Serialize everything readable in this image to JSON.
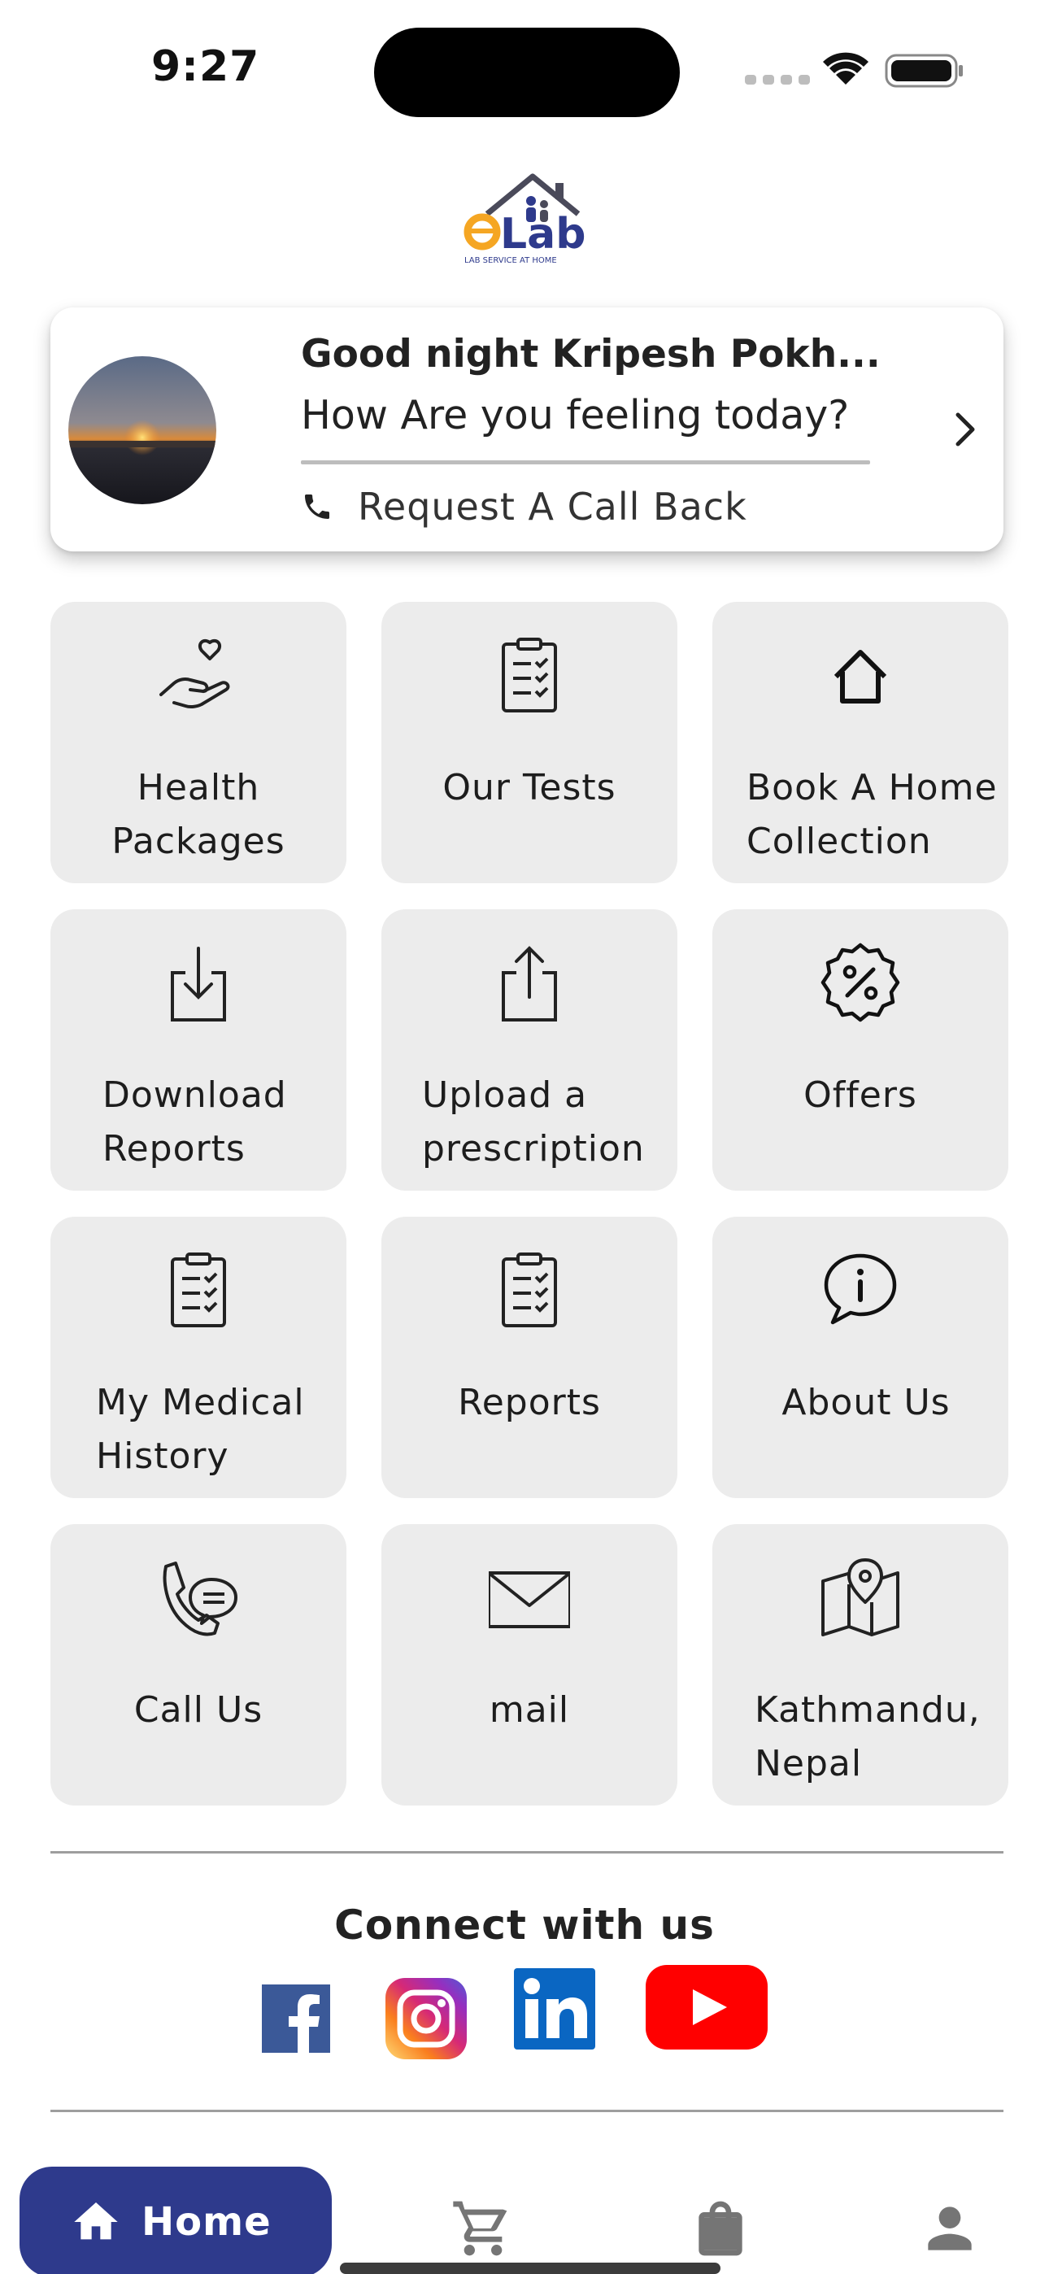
{
  "status_bar": {
    "time": "9:27"
  },
  "brand": {
    "logo_text": "eLab",
    "tagline": "LAB SERVICE AT HOME"
  },
  "greeting": {
    "title": "Good night Kripesh Pokh...",
    "subtitle": "How Are you feeling today?",
    "callback_label": "Request A Call Back"
  },
  "tiles": [
    {
      "label": "Health Packages",
      "icon": "heart-hand-icon"
    },
    {
      "label": "Our Tests",
      "icon": "clipboard-check-icon"
    },
    {
      "label": "Book A Home Collection",
      "icon": "home-icon"
    },
    {
      "label": "Download Reports",
      "icon": "download-icon"
    },
    {
      "label": "Upload a prescription",
      "icon": "upload-icon"
    },
    {
      "label": "Offers",
      "icon": "percent-badge-icon"
    },
    {
      "label": "My Medical History",
      "icon": "clipboard-check-icon"
    },
    {
      "label": "Reports",
      "icon": "clipboard-check-icon"
    },
    {
      "label": "About Us",
      "icon": "info-chat-icon"
    },
    {
      "label": "Call Us",
      "icon": "phone-chat-icon"
    },
    {
      "label": "mail",
      "icon": "envelope-icon"
    },
    {
      "label": "Kathmandu, Nepal",
      "icon": "map-pin-icon"
    }
  ],
  "connect": {
    "title": "Connect with us",
    "links": [
      "facebook",
      "instagram",
      "linkedin",
      "youtube"
    ]
  },
  "bottom_nav": {
    "home_label": "Home",
    "items": [
      "home",
      "cart",
      "shopping-bag",
      "profile"
    ]
  },
  "colors": {
    "primary": "#2e3a8c",
    "tile_bg": "#ececec",
    "logo_orange": "#f5a623",
    "facebook": "#3b5998",
    "linkedin": "#0a66c2",
    "youtube": "#ff0000"
  }
}
